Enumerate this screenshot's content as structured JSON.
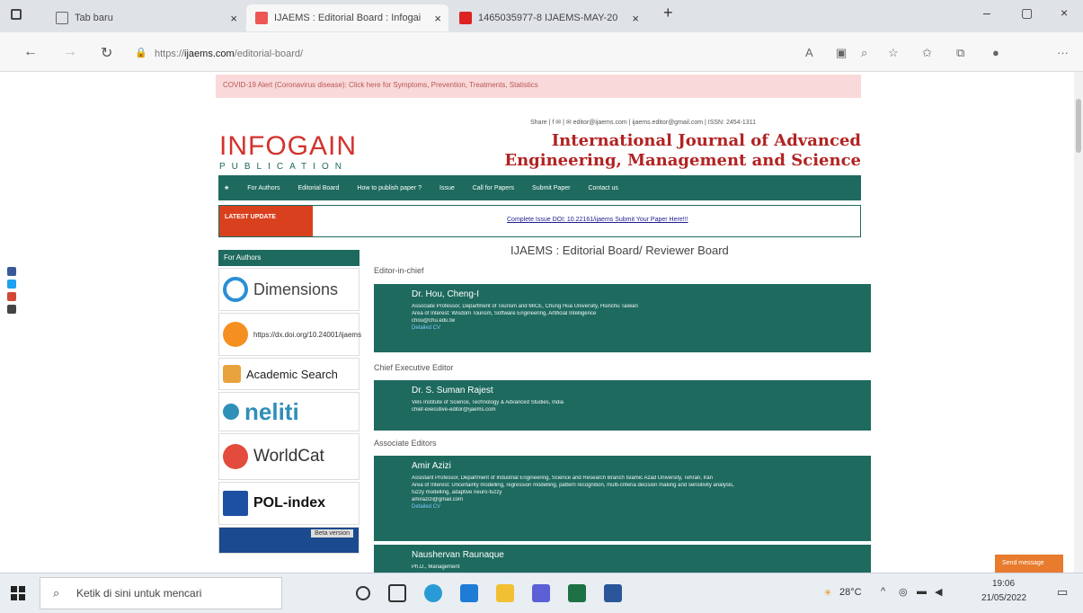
{
  "browser": {
    "tabs": [
      {
        "label": "Tab baru",
        "close": "×"
      },
      {
        "label": "IJAEMS : Editorial Board : Infogai",
        "close": "×"
      },
      {
        "label": "1465035977-8 IJAEMS-MAY-20",
        "close": "×"
      }
    ],
    "new_tab": "+",
    "window_controls": {
      "minimize": "–",
      "maximize": "▢",
      "close": "×"
    },
    "back": "←",
    "forward": "→",
    "refresh": "↻",
    "url_prefix": "https://",
    "url_domain": "ijaems.com",
    "url_path": "/editorial-board/",
    "more": "···"
  },
  "page": {
    "covid_banner": "COVID-19 Alert (Coronavirus disease): Click here for Symptoms, Prevention, Treatments, Statistics",
    "contact_line": "Share | f ✉ | ✉ editor@ijaems.com | ijaems.editor@gmail.com | ISSN: 2454-1311",
    "logo_main": "INFOGAIN",
    "logo_sub": "PUBLICATION",
    "journal_title_1": "International Journal of Advanced",
    "journal_title_2": "Engineering, Management and Science",
    "nav": [
      "★",
      "For Authors",
      "Editorial Board",
      "How to publish paper ?",
      "Issue",
      "Call for Papers",
      "Submit Paper",
      "Contact us"
    ],
    "latest_badge": "LATEST UPDATE",
    "latest_ticker": "Complete Issue   DOI: 10.22161/ijaems   Submit Your Paper Here!!!",
    "sidebar_title": "For Authors",
    "sidebar_logos": [
      "Dimensions",
      "https://dx.doi.org/10.24001/ijaems",
      "Academic Search",
      "neliti",
      "WorldCat",
      "POL-index",
      "Beta version"
    ],
    "heading": "IJAEMS : Editorial Board/ Reviewer Board",
    "sections": [
      {
        "label": "Editor-in-chief",
        "members": [
          {
            "name": "Dr. Hou, Cheng-I",
            "lines": [
              "Associate Professor, Department of Tourism and MICE, Chung Hua University, Hsinchu Taiwan",
              "Area of Interest: Wisdom Tourism, Software Engineering, Artificial Intelligence",
              "chou@chu.edu.tw"
            ],
            "link": "Detailed CV"
          }
        ]
      },
      {
        "label": "Chief Executive Editor",
        "members": [
          {
            "name": "Dr. S. Suman Rajest",
            "lines": [
              "Vels Institute of Science, Technology & Advanced Studies, India",
              "chief-executive-editor@ijaems.com"
            ],
            "link": ""
          }
        ]
      },
      {
        "label": "Associate Editors",
        "members": [
          {
            "name": "Amir Azizi",
            "lines": [
              "Assistant Professor, Department of Industrial Engineering, Science and Research Branch Islamic Azad University, Tehran, Iran",
              "Area of Interest: Uncertainty modelling, regression modelling, pattern recognition, multi-criteria decision making and sensitivity analysis,",
              "fuzzy modelling, adaptive neuro-fuzzy",
              "amirazizi@gmail.com"
            ],
            "link": "Detailed CV"
          },
          {
            "name": "Naushervan Raunaque",
            "lines": [
              "Ph.D., Management"
            ],
            "link": ""
          }
        ]
      }
    ],
    "send_message": "Send message"
  },
  "taskbar": {
    "search_placeholder": "Ketik di sini untuk mencari",
    "weather": "28°C",
    "time": "19:06",
    "date": "21/05/2022"
  },
  "colors": {
    "brand_green": "#1e6a5e",
    "brand_red": "#d2322d",
    "alert_bg": "#f9d9d9"
  }
}
